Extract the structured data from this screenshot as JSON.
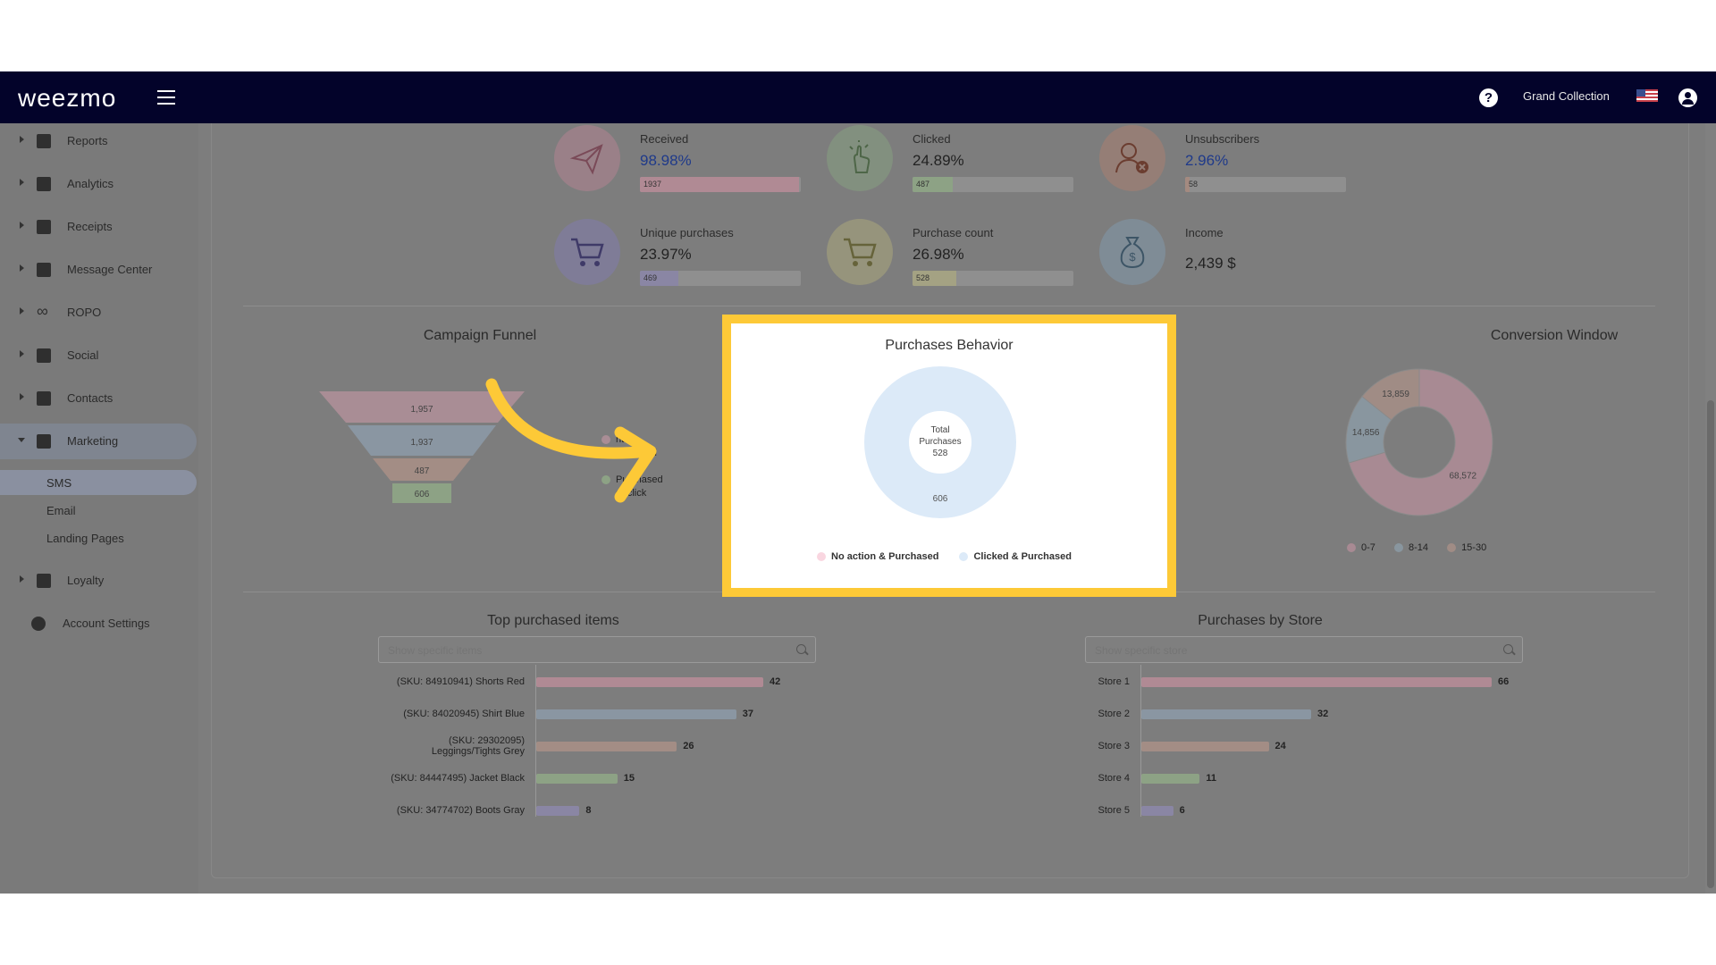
{
  "topbar": {
    "logo": "weezmo",
    "account_name": "Grand Collection"
  },
  "sidebar": {
    "items": [
      {
        "label": "Reports",
        "icon": "dashboard-icon"
      },
      {
        "label": "Analytics",
        "icon": "analytics-icon"
      },
      {
        "label": "Receipts",
        "icon": "receipt-icon"
      },
      {
        "label": "Message Center",
        "icon": "message-icon"
      },
      {
        "label": "ROPO",
        "icon": "infinity-icon"
      },
      {
        "label": "Social",
        "icon": "people-icon"
      },
      {
        "label": "Contacts",
        "icon": "contacts-icon"
      },
      {
        "label": "Marketing",
        "icon": "megaphone-icon"
      }
    ],
    "sub_items": [
      "SMS",
      "Email",
      "Landing Pages"
    ],
    "loyalty": "Loyalty",
    "account_settings": "Account Settings"
  },
  "stats": [
    {
      "label": "Received",
      "value": "98.98%",
      "bar_text": "1937",
      "fill": 0.99,
      "color": "#b08a94",
      "icon": "paper-plane-icon"
    },
    {
      "label": "Clicked",
      "value": "24.89%",
      "bar_text": "487",
      "fill": 0.25,
      "color": "#8da285",
      "icon": "pointer-hand-icon"
    },
    {
      "label": "Unsubscribers",
      "value": "2.96%",
      "bar_text": "58",
      "fill": 0.03,
      "color": "#a48a80",
      "icon": "user-remove-icon"
    },
    {
      "label": "Unique purchases",
      "value": "23.97%",
      "bar_text": "469",
      "fill": 0.24,
      "color": "#8a86a4",
      "icon": "cart-icon"
    },
    {
      "label": "Purchase count",
      "value": "26.98%",
      "bar_text": "528",
      "fill": 0.27,
      "color": "#a4a283",
      "icon": "cart-icon"
    },
    {
      "label": "Income",
      "value": "2,439 $",
      "color": "#8b9aa4",
      "icon": "money-bag-icon"
    }
  ],
  "campaign_funnel": {
    "title": "Campaign Funnel",
    "levels": [
      "1,957",
      "1,937",
      "487",
      "606"
    ],
    "legend_fragments": [
      "nt",
      "Received",
      "Purchased",
      "er click"
    ]
  },
  "purchases_behavior": {
    "title": "Purchases Behavior",
    "center_label": [
      "Total",
      "Purchases"
    ],
    "total": "528",
    "slice_label": "606",
    "legend": [
      {
        "label": "No action & Purchased",
        "color": "#f9d6e0"
      },
      {
        "label": "Clicked & Purchased",
        "color": "#dceaf8"
      }
    ]
  },
  "chart_data": {
    "type": "pie",
    "title": "Purchases Behavior",
    "categories": [
      "No action & Purchased",
      "Clicked & Purchased"
    ],
    "values": [
      0,
      606
    ],
    "center_text": "Total Purchases 528"
  },
  "conversion_window": {
    "title": "Conversion Window",
    "slices": [
      {
        "label": "0-7",
        "value": "68,572",
        "num": 68572,
        "color": "#a88a93"
      },
      {
        "label": "8-14",
        "value": "14,856",
        "num": 14856,
        "color": "#89969f"
      },
      {
        "label": "15-30",
        "value": "13,859",
        "num": 13859,
        "color": "#a08c85"
      }
    ]
  },
  "top_items": {
    "title": "Top purchased items",
    "placeholder": "Show specific items",
    "rows": [
      {
        "label": "(SKU: 84910941) Shorts Red",
        "value": 42,
        "color": "#b08a94"
      },
      {
        "label": "(SKU: 84020945) Shirt Blue",
        "value": 37,
        "color": "#8a96a2"
      },
      {
        "label": "(SKU: 29302095) Leggings/Tights Grey",
        "value": 26,
        "color": "#a38d85"
      },
      {
        "label": "(SKU: 84447495) Jacket Black",
        "value": 15,
        "color": "#8da285"
      },
      {
        "label": "(SKU: 34774702) Boots Gray",
        "value": 8,
        "color": "#8a86a4"
      }
    ]
  },
  "by_store": {
    "title": "Purchases by Store",
    "placeholder": "Show specific store",
    "rows": [
      {
        "label": "Store 1",
        "value": 66,
        "color": "#b08a94"
      },
      {
        "label": "Store 2",
        "value": 32,
        "color": "#8a96a2"
      },
      {
        "label": "Store 3",
        "value": 24,
        "color": "#a38d85"
      },
      {
        "label": "Store 4",
        "value": 11,
        "color": "#8da285"
      },
      {
        "label": "Store 5",
        "value": 6,
        "color": "#8a86a4"
      }
    ]
  }
}
